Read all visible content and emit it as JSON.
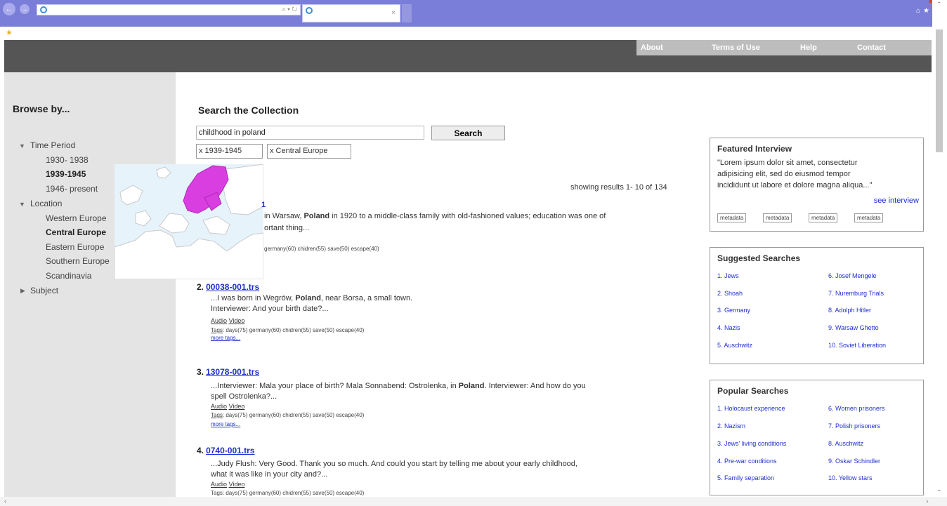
{
  "browser": {
    "address": "",
    "tab_title": "",
    "addr_controls": "⌕ ▾ ↻",
    "tab_close": "×",
    "window_icons": "⌂★⚙"
  },
  "site_nav": {
    "items": [
      "About",
      "Terms of Use",
      "Help",
      "Contact"
    ]
  },
  "sidebar": {
    "title": "Browse by...",
    "time_period": "Time Period",
    "periods": [
      "1930- 1938",
      "1939-1945",
      "1946- present"
    ],
    "location": "Location",
    "locations": [
      "Western Europe",
      "Central Europe",
      "Eastern Europe",
      "Southern Europe",
      "Scandinavia"
    ],
    "subject": "Subject"
  },
  "search": {
    "title": "Search the Collection",
    "query": "childhood in poland",
    "button": "Search",
    "filters": [
      "x  1939-1945",
      "x  Central Europe"
    ],
    "showing": "showing results 1- 10 of 134"
  },
  "results": [
    {
      "num": "",
      "id": "",
      "pre": "in Warsaw, ",
      "bold": "Poland",
      "post": " in 1920 to a middle-class family with old-fashioned values; education was one of",
      "line2": "ortant thing...",
      "tags": "germany(60) chidren(55) save(50) escape(40)"
    },
    {
      "num": "2.",
      "id": "00038-001.trs",
      "pre": "...I was born in Wegrów, ",
      "bold": "Poland",
      "post": ", near Borsa, a small town.",
      "line2": "Interviewer: And your birth date?...",
      "audio": "Audio",
      "video": "Video",
      "tags_label": "Tags",
      "tags": ": days(75) germany(60) chidren(55) save(50) escape(40)",
      "more": "more tags..."
    },
    {
      "num": "3.",
      "id": "13078-001.trs",
      "pre": "...Interviewer: Mala your place of birth? Mala Sonnabend: Ostrolenka, in ",
      "bold": "Poland",
      "post": ". Interviewer: And how do you",
      "line2": "spell Ostrolenka?...",
      "audio": "Audio",
      "video": "Video",
      "tags_label": "Tags",
      "tags": ": days(75) germany(60) chidren(55) save(50) escape(40)",
      "more": "more tags..."
    },
    {
      "num": "4.",
      "id": "0740-001.trs",
      "pre": "...Judy Flush: Very Good. Thank you so much. And could you start by telling me about your early childhood,",
      "bold": "",
      "post": "",
      "line2": "what it was like in your city and?...",
      "audio": "Audio",
      "video": "Video",
      "tags": "Tags: days(75) germany(60) chidren(55) save(50) escape(40)"
    }
  ],
  "featured": {
    "title": "Featured Interview",
    "text": [
      "\"Lorem ipsum dolor sit amet, consectetur",
      "adipisicing elit, sed do eiusmod tempor",
      "incididunt ut labore et dolore magna aliqua...\""
    ],
    "link": "see interview",
    "meta": [
      "metadata",
      "metadata",
      "metadata",
      "metadata"
    ]
  },
  "suggested": {
    "title": "Suggested Searches",
    "left": [
      "1. Jews",
      "2. Shoah",
      "3. Germany",
      "4. Nazis",
      "5. Auschwitz"
    ],
    "right": [
      "6. Josef Mengele",
      "7. Nuremburg Trials",
      "8. Adolph Hitler",
      "9. Warsaw Ghetto",
      "10. Soviet Liberation"
    ]
  },
  "popular": {
    "title": "Popular Searches",
    "left": [
      "1. Holocaust experience",
      "2. Nazism",
      "3. Jews' living conditions",
      "4. Pre-war conditions",
      "5. Family separation"
    ],
    "right": [
      "6. Women prisoners",
      "7. Polish prisoners",
      "8. Auschwitz",
      "9. Oskar Schindler",
      "10. Yellow stars"
    ]
  },
  "colors": {
    "accent": "#7b7ed8",
    "link": "#1f2fd0",
    "map_highlight": "#d83ee0"
  },
  "icons": [
    "back-icon",
    "forward-icon",
    "ie-icon",
    "home-icon",
    "star-icon",
    "gear-icon",
    "favorites-icon",
    "triangle-down-icon",
    "triangle-right-icon"
  ]
}
